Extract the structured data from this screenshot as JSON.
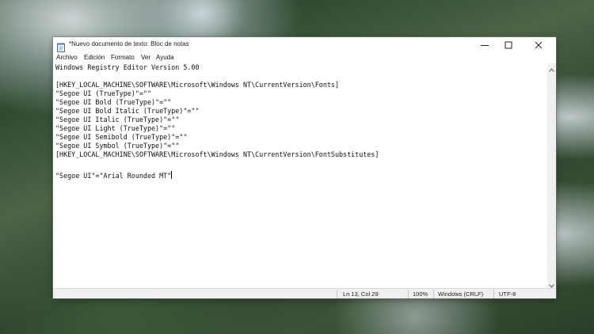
{
  "window": {
    "title": "*Nuevo documento de texto: Bloc de notas",
    "controls": {
      "minimize_icon": "minimize-icon",
      "maximize_icon": "maximize-icon",
      "close_icon": "close-icon"
    }
  },
  "menu": {
    "items": [
      {
        "label": "Archivo"
      },
      {
        "label": "Edición"
      },
      {
        "label": "Formato"
      },
      {
        "label": "Ver"
      },
      {
        "label": "Ayuda"
      }
    ]
  },
  "editor": {
    "lines": [
      "Windows Registry Editor Version 5.00",
      "",
      "[HKEY_LOCAL_MACHINE\\SOFTWARE\\Microsoft\\Windows NT\\CurrentVersion\\Fonts]",
      "\"Segoe UI (TrueType)\"=\"\"",
      "\"Segoe UI Bold (TrueType)\"=\"\"",
      "\"Segoe UI Bold Italic (TrueType)\"=\"\"",
      "\"Segoe UI Italic (TrueType)\"=\"\"",
      "\"Segoe UI Light (TrueType)\"=\"\"",
      "\"Segoe UI Semibold (TrueType)\"=\"\"",
      "\"Segoe UI Symbol (TrueType)\"=\"\"",
      "[HKEY_LOCAL_MACHINE\\SOFTWARE\\Microsoft\\Windows NT\\CurrentVersion\\FontSubstitutes]",
      "",
      "\"Segoe UI\"=\"Arial Rounded MT\""
    ],
    "caret_line": 13
  },
  "status": {
    "position": "Ln 13, Col 29",
    "zoom": "100%",
    "line_ending": "Windows (CRLF)",
    "encoding": "UTF-8"
  },
  "colors": {
    "window_bg": "#ffffff",
    "status_bg": "#f0f0f0",
    "text": "#111111"
  }
}
